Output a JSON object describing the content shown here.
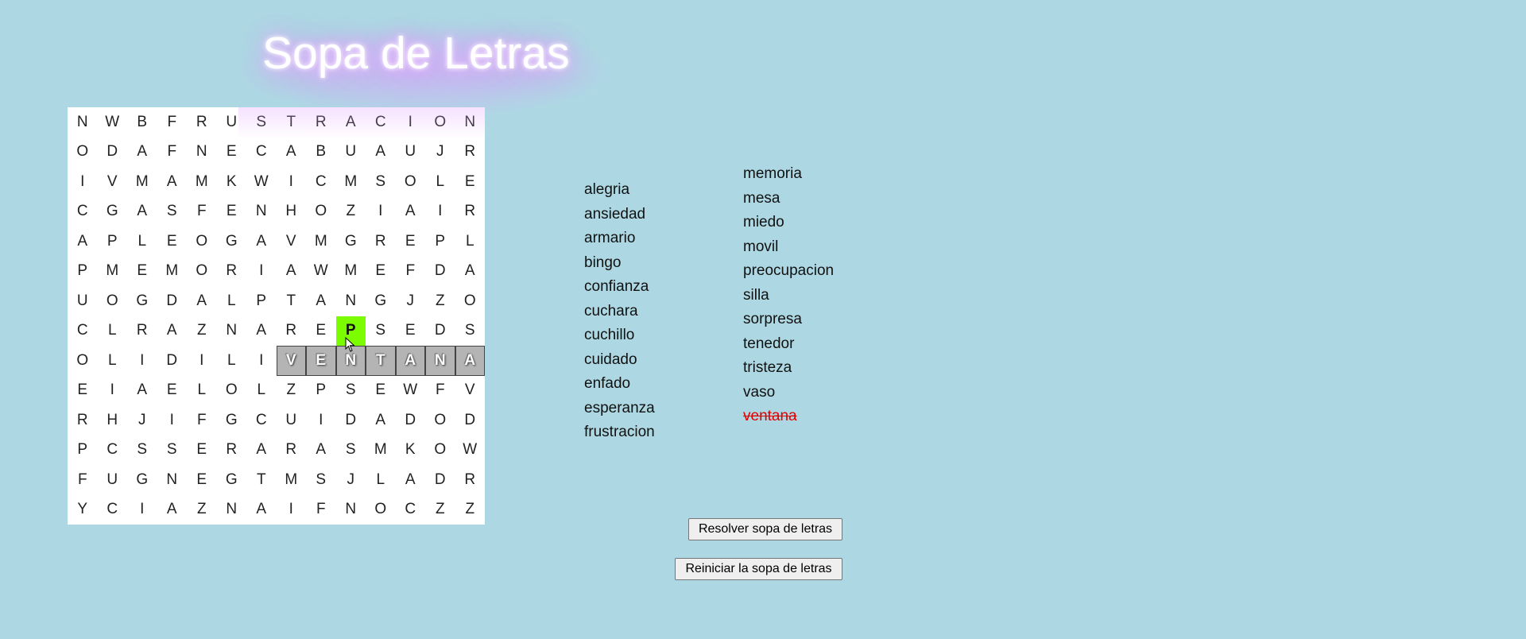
{
  "title": "Sopa de Letras",
  "grid": [
    [
      "N",
      "W",
      "B",
      "F",
      "R",
      "U",
      "S",
      "T",
      "R",
      "A",
      "C",
      "I",
      "O",
      "N"
    ],
    [
      "O",
      "D",
      "A",
      "F",
      "N",
      "E",
      "C",
      "A",
      "B",
      "U",
      "A",
      "U",
      "J",
      "R"
    ],
    [
      "I",
      "V",
      "M",
      "A",
      "M",
      "K",
      "W",
      "I",
      "C",
      "M",
      "S",
      "O",
      "L",
      "E"
    ],
    [
      "C",
      "G",
      "A",
      "S",
      "F",
      "E",
      "N",
      "H",
      "O",
      "Z",
      "I",
      "A",
      "I",
      "R"
    ],
    [
      "A",
      "P",
      "L",
      "E",
      "O",
      "G",
      "A",
      "V",
      "M",
      "G",
      "R",
      "E",
      "P",
      "L"
    ],
    [
      "P",
      "M",
      "E",
      "M",
      "O",
      "R",
      "I",
      "A",
      "W",
      "M",
      "E",
      "F",
      "D",
      "A"
    ],
    [
      "U",
      "O",
      "G",
      "D",
      "A",
      "L",
      "P",
      "T",
      "A",
      "N",
      "G",
      "J",
      "Z",
      "O"
    ],
    [
      "C",
      "L",
      "R",
      "A",
      "Z",
      "N",
      "A",
      "R",
      "E",
      "P",
      "S",
      "E",
      "D",
      "S"
    ],
    [
      "O",
      "L",
      "I",
      "D",
      "I",
      "L",
      "I",
      "V",
      "E",
      "N",
      "T",
      "A",
      "N",
      "A"
    ],
    [
      "E",
      "I",
      "A",
      "E",
      "L",
      "O",
      "L",
      "Z",
      "P",
      "S",
      "E",
      "W",
      "F",
      "V"
    ],
    [
      "R",
      "H",
      "J",
      "I",
      "F",
      "G",
      "C",
      "U",
      "I",
      "D",
      "A",
      "D",
      "O",
      "D"
    ],
    [
      "P",
      "C",
      "S",
      "S",
      "E",
      "R",
      "A",
      "R",
      "A",
      "S",
      "M",
      "K",
      "O",
      "W"
    ],
    [
      "F",
      "U",
      "G",
      "N",
      "E",
      "G",
      "T",
      "M",
      "S",
      "J",
      "L",
      "A",
      "D",
      "R"
    ],
    [
      "Y",
      "C",
      "I",
      "A",
      "Z",
      "N",
      "A",
      "I",
      "F",
      "N",
      "O",
      "C",
      "Z",
      "Z"
    ]
  ],
  "found_cells": [
    [
      8,
      7
    ],
    [
      8,
      8
    ],
    [
      8,
      9
    ],
    [
      8,
      10
    ],
    [
      8,
      11
    ],
    [
      8,
      12
    ],
    [
      8,
      13
    ]
  ],
  "selected_cells": [
    [
      7,
      9
    ]
  ],
  "word_list_col1": [
    "alegria",
    "ansiedad",
    "armario",
    "bingo",
    "confianza",
    "cuchara",
    "cuchillo",
    "cuidado",
    "enfado",
    "esperanza",
    "frustracion"
  ],
  "word_list_col2": [
    "memoria",
    "mesa",
    "miedo",
    "movil",
    "preocupacion",
    "silla",
    "sorpresa",
    "tenedor",
    "tristeza",
    "vaso",
    "ventana"
  ],
  "found_words": [
    "ventana"
  ],
  "colors": {
    "background": "#add8e3",
    "found_cell": "#b4b4b4",
    "selected_cell": "#7cfc00",
    "found_word": "#e00000",
    "title_glow": "#d08cff"
  },
  "buttons": {
    "solve": "Resolver sopa de letras",
    "reset": "Reiniciar la sopa de letras"
  }
}
